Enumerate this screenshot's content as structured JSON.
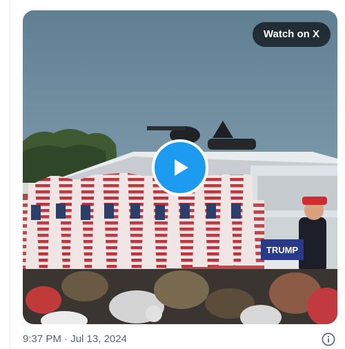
{
  "media": {
    "watch_label": "Watch on X",
    "play_label": "Play",
    "play_icon": "play-icon",
    "accent_color": "#1d9bf0",
    "podium_text": "TRUMP"
  },
  "post": {
    "time": "9:37 PM",
    "separator": "·",
    "date": "Jul 13, 2024",
    "info_icon": "info-icon"
  }
}
